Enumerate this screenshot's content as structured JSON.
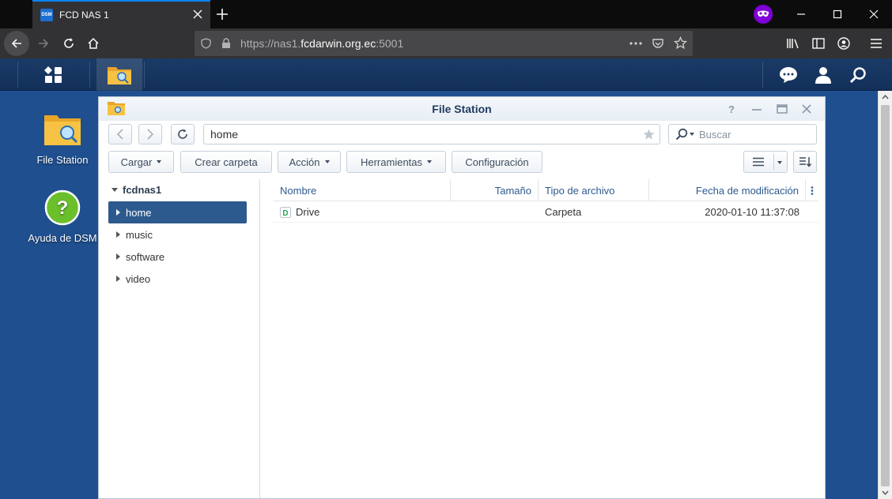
{
  "browser": {
    "tab_title": "FCD NAS 1",
    "favicon_text": "DSM",
    "url_prefix": "https://nas1.",
    "url_host": "fcdarwin.org.ec",
    "url_suffix": ":5001"
  },
  "desktop": {
    "icons": [
      {
        "label": "File Station"
      },
      {
        "label": "Ayuda de DSM"
      }
    ]
  },
  "window": {
    "title": "File Station",
    "path": "home",
    "search_placeholder": "Buscar",
    "toolbar": {
      "upload": "Cargar",
      "create_folder": "Crear carpeta",
      "action": "Acción",
      "tools": "Herramientas",
      "settings": "Configuración"
    },
    "tree": {
      "root": "fcdnas1",
      "items": [
        {
          "label": "home",
          "selected": true
        },
        {
          "label": "music"
        },
        {
          "label": "software"
        },
        {
          "label": "video"
        }
      ]
    },
    "columns": {
      "name": "Nombre",
      "size": "Tamaño",
      "type": "Tipo de archivo",
      "modified": "Fecha de modificación"
    },
    "rows": [
      {
        "name": "Drive",
        "size": "",
        "type": "Carpeta",
        "modified": "2020-01-10 11:37:08"
      }
    ]
  },
  "colors": {
    "accent": "#2d5a8e",
    "desktop_bg": "#1f4f8f",
    "browser_dark": "#323234"
  }
}
